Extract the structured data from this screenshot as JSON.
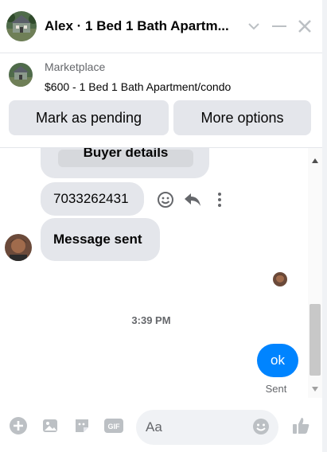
{
  "header": {
    "title": "Alex · 1 Bed 1 Bath Apartm...",
    "icons": [
      "chevron-down-icon",
      "minimize-icon",
      "close-icon"
    ]
  },
  "listing": {
    "source": "Marketplace",
    "title": "$600 - 1 Bed 1 Bath Apartment/condo",
    "buttons": {
      "pending": "Mark as pending",
      "more": "More options"
    }
  },
  "messages": {
    "buyer_details": "Buyer details",
    "phone": "7033262431",
    "sent": "Message sent",
    "time": "3:39 PM",
    "ok": "ok",
    "status": "Sent",
    "reaction_icons": [
      "smiley-icon",
      "reply-icon",
      "more-vertical-icon"
    ]
  },
  "composer": {
    "placeholder": "Aa",
    "icons": [
      "plus-circle-icon",
      "image-icon",
      "sticker-icon",
      "gif-icon",
      "emoji-icon",
      "thumbs-up-icon"
    ]
  },
  "colors": {
    "accent": "#0084ff",
    "bubble_gray": "#e4e6eb",
    "icon_gray": "#bcc0c4",
    "secondary_text": "#65676b"
  }
}
